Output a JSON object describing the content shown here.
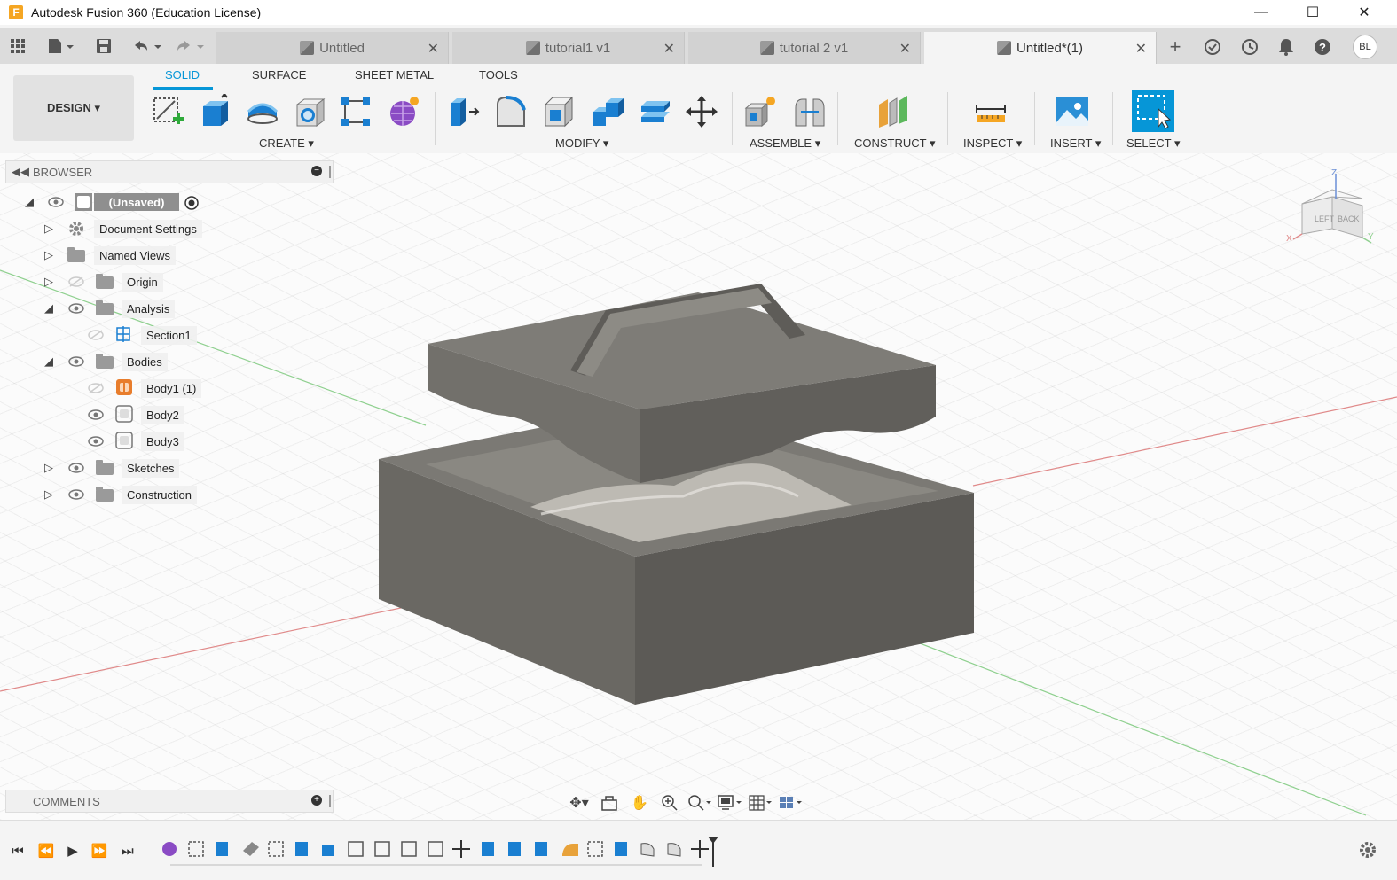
{
  "window": {
    "title": "Autodesk Fusion 360 (Education License)",
    "logo_letter": "F"
  },
  "tabs": [
    {
      "label": "Untitled",
      "active": false
    },
    {
      "label": "tutorial1 v1",
      "active": false
    },
    {
      "label": "tutorial 2 v1",
      "active": false
    },
    {
      "label": "Untitled*(1)",
      "active": true
    }
  ],
  "user": {
    "initials": "BL"
  },
  "ribbon": {
    "workspace": "DESIGN ▾",
    "tabs": [
      "SOLID",
      "SURFACE",
      "SHEET METAL",
      "TOOLS"
    ],
    "groups": {
      "create": "CREATE ▾",
      "modify": "MODIFY ▾",
      "assemble": "ASSEMBLE ▾",
      "construct": "CONSTRUCT ▾",
      "inspect": "INSPECT ▾",
      "insert": "INSERT ▾",
      "select": "SELECT ▾"
    }
  },
  "browser": {
    "title": "BROWSER",
    "root": "(Unsaved)",
    "items": {
      "document_settings": "Document Settings",
      "named_views": "Named Views",
      "origin": "Origin",
      "analysis": "Analysis",
      "section1": "Section1",
      "bodies": "Bodies",
      "body1": "Body1 (1)",
      "body2": "Body2",
      "body3": "Body3",
      "sketches": "Sketches",
      "construction": "Construction"
    }
  },
  "comments": {
    "title": "COMMENTS"
  },
  "viewcube": {
    "top": "Z",
    "left_face": "LEFT",
    "back_face": "BACK",
    "axis_x": "X",
    "axis_y": "Y"
  },
  "colors": {
    "accent": "#0696d7",
    "model": "#6e6c67",
    "axis_red": "#e06060",
    "axis_green": "#5cb85c"
  }
}
